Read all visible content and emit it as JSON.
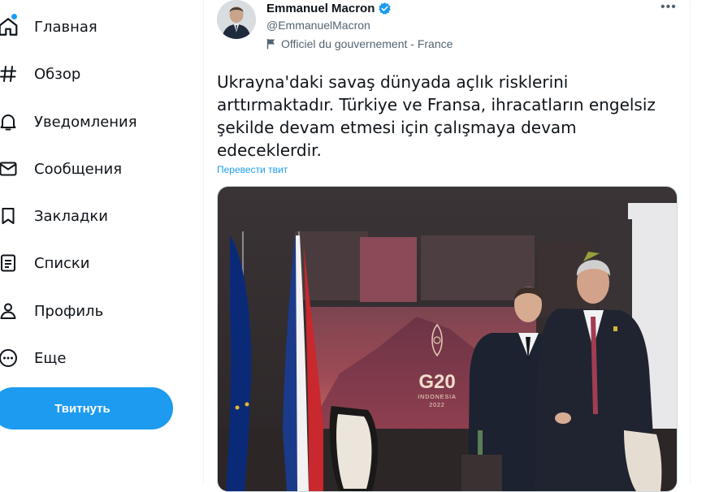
{
  "sidebar": {
    "items": [
      {
        "label": "Главная",
        "icon": "home-icon"
      },
      {
        "label": "Обзор",
        "icon": "hashtag-icon"
      },
      {
        "label": "Уведомления",
        "icon": "bell-icon"
      },
      {
        "label": "Сообщения",
        "icon": "mail-icon"
      },
      {
        "label": "Закладки",
        "icon": "bookmark-icon"
      },
      {
        "label": "Списки",
        "icon": "list-icon"
      },
      {
        "label": "Профиль",
        "icon": "person-icon"
      },
      {
        "label": "Еще",
        "icon": "more-circle-icon"
      }
    ],
    "tweet_button": "Твитнуть"
  },
  "tweet": {
    "author_name": "Emmanuel Macron",
    "handle": "@EmmanuelMacron",
    "affiliation": "Officiel du gouvernement - France",
    "text": "Ukrayna'daki savaş dünyada açlık risklerini arttırmaktadır. Türkiye ve Fransa, ihracatların engelsiz şekilde devam etmesi için çalışmaya devam edeceklerdir.",
    "translate_label": "Перевести твит",
    "photo": {
      "logo_text": "G20",
      "logo_sub1": "INDONESIA",
      "logo_sub2": "2022"
    }
  },
  "colors": {
    "accent": "#1d9bf0",
    "text": "#0f1419",
    "muted": "#536471"
  }
}
